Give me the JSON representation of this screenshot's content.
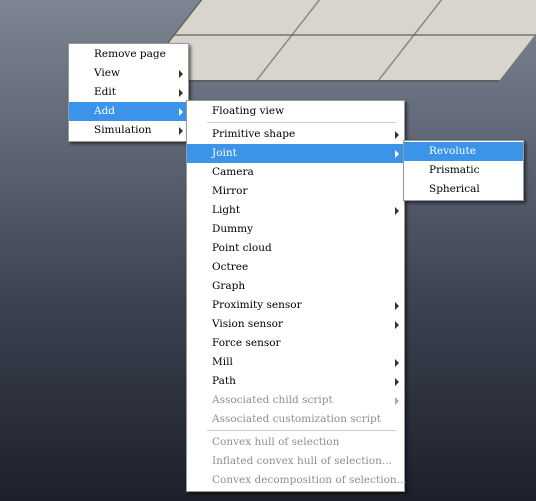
{
  "context_menu": {
    "items": [
      {
        "label": "Remove page"
      },
      {
        "label": "View"
      },
      {
        "label": "Edit"
      },
      {
        "label": "Add"
      },
      {
        "label": "Simulation"
      }
    ]
  },
  "add_submenu": {
    "items": [
      {
        "label": "Floating view"
      },
      {
        "label": "Primitive shape"
      },
      {
        "label": "Joint"
      },
      {
        "label": "Camera"
      },
      {
        "label": "Mirror"
      },
      {
        "label": "Light"
      },
      {
        "label": "Dummy"
      },
      {
        "label": "Point cloud"
      },
      {
        "label": "Octree"
      },
      {
        "label": "Graph"
      },
      {
        "label": "Proximity sensor"
      },
      {
        "label": "Vision sensor"
      },
      {
        "label": "Force sensor"
      },
      {
        "label": "Mill"
      },
      {
        "label": "Path"
      },
      {
        "label": "Associated child script"
      },
      {
        "label": "Associated customization script"
      },
      {
        "label": "Convex hull of selection"
      },
      {
        "label": "Inflated convex hull of selection..."
      },
      {
        "label": "Convex decomposition of selection..."
      }
    ]
  },
  "joint_submenu": {
    "items": [
      {
        "label": "Revolute"
      },
      {
        "label": "Prismatic"
      },
      {
        "label": "Spherical"
      }
    ]
  },
  "colors": {
    "highlight": "#3b94ea",
    "disabled_text": "#8e8e8e",
    "menu_background": "#ffffff"
  }
}
